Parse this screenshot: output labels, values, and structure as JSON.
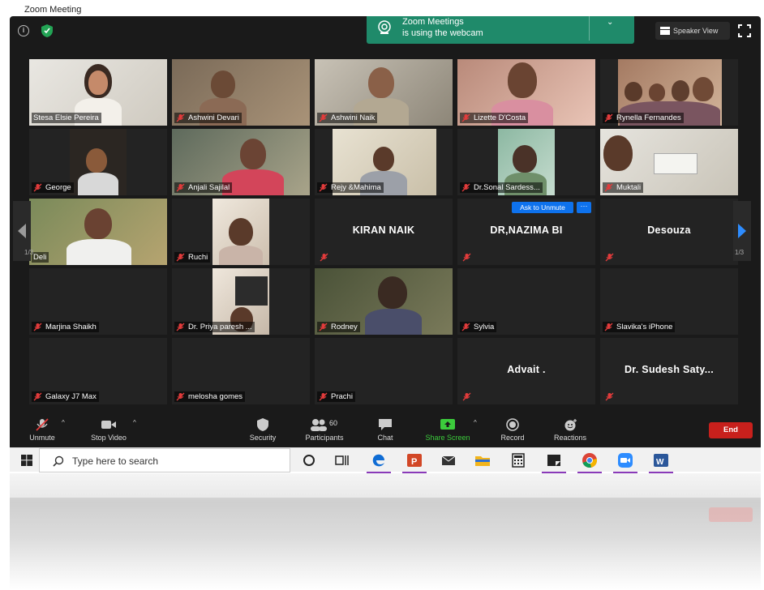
{
  "window": {
    "caption": "Zoom Meeting"
  },
  "banner": {
    "line1": "Zoom Meetings",
    "line2": "is using the webcam"
  },
  "speaker_view_label": "Speaker View",
  "pagination": {
    "left": "1/3",
    "right": "1/3"
  },
  "ask_unmute_label": "Ask to Unmute",
  "more_label": "···",
  "participants": {
    "r1": [
      "Stesa Elsie Pereira",
      "Ashwini Devari",
      "Ashwini Naik",
      "Lizette D'Costa",
      "Rynella Fernandes"
    ],
    "r2": [
      "George",
      "Anjali Sajilal",
      "Rejy &Mahima",
      "Dr.Sonal Sardess...",
      "Muktali"
    ],
    "r3_left_partial": "Deli",
    "r3_ruchi": "Ruchi",
    "r3_names": [
      "KIRAN NAIK",
      "DR,NAZIMA BI",
      "Desouza"
    ],
    "r4": [
      "Marjina Shaikh",
      "Dr. Priya paresh ...",
      "Rodney",
      "Sylvia",
      "Slavika's iPhone"
    ],
    "r5": [
      "Galaxy J7 Max",
      "melosha gomes",
      "Prachi"
    ],
    "r5_names": [
      "Advait .",
      "Dr. Sudesh Saty..."
    ]
  },
  "toolbar": {
    "unmute": "Unmute",
    "stop_video": "Stop Video",
    "security": "Security",
    "participants": "Participants",
    "participants_count": "60",
    "chat": "Chat",
    "share_screen": "Share Screen",
    "record": "Record",
    "reactions": "Reactions",
    "end": "End"
  },
  "taskbar": {
    "search_placeholder": "Type here to search"
  },
  "colors": {
    "share_green": "#3ccc3c",
    "end_red": "#c8201c",
    "active_border": "#d6e84e",
    "banner_green": "#1f8a6a",
    "ask_blue": "#0e72ed"
  }
}
